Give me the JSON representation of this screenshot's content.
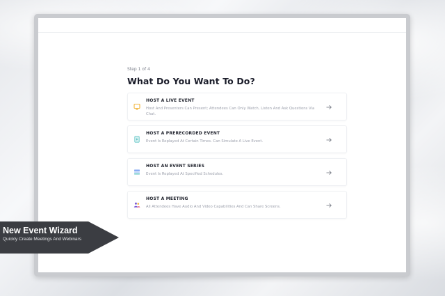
{
  "wizard": {
    "step_label": "Step 1 of 4",
    "title": "What Do You Want To Do?",
    "options": [
      {
        "title": "HOST A LIVE EVENT",
        "description": "Host And Presenters Can Present; Attendees Can Only Watch, Listen And Ask Questions Via Chat.",
        "icon": "presentation-board-icon"
      },
      {
        "title": "HOST A PRERECORDED EVENT",
        "description": "Event Is Replayed At Certain Times. Can Simulate A Live Event.",
        "icon": "recorded-file-icon"
      },
      {
        "title": "HOST AN EVENT SERIES",
        "description": "Event Is Replayed At Specified Schedules.",
        "icon": "event-series-list-icon"
      },
      {
        "title": "HOST A MEETING",
        "description": "All Attendees Have Audio And Video Capabilities And Can Share Screens.",
        "icon": "meeting-people-icon"
      }
    ],
    "arrow_icon": "arrow-right-icon"
  },
  "banner": {
    "title": "New Event Wizard",
    "subtitle": "Quickly Create Meetings And Webinars"
  },
  "colors": {
    "icon_yellow": "#f2b53b",
    "icon_teal": "#5fc3c4",
    "icon_blue": "#5f8ff0",
    "icon_purple": "#7b5cd6",
    "banner_bg": "#3b3d42"
  }
}
